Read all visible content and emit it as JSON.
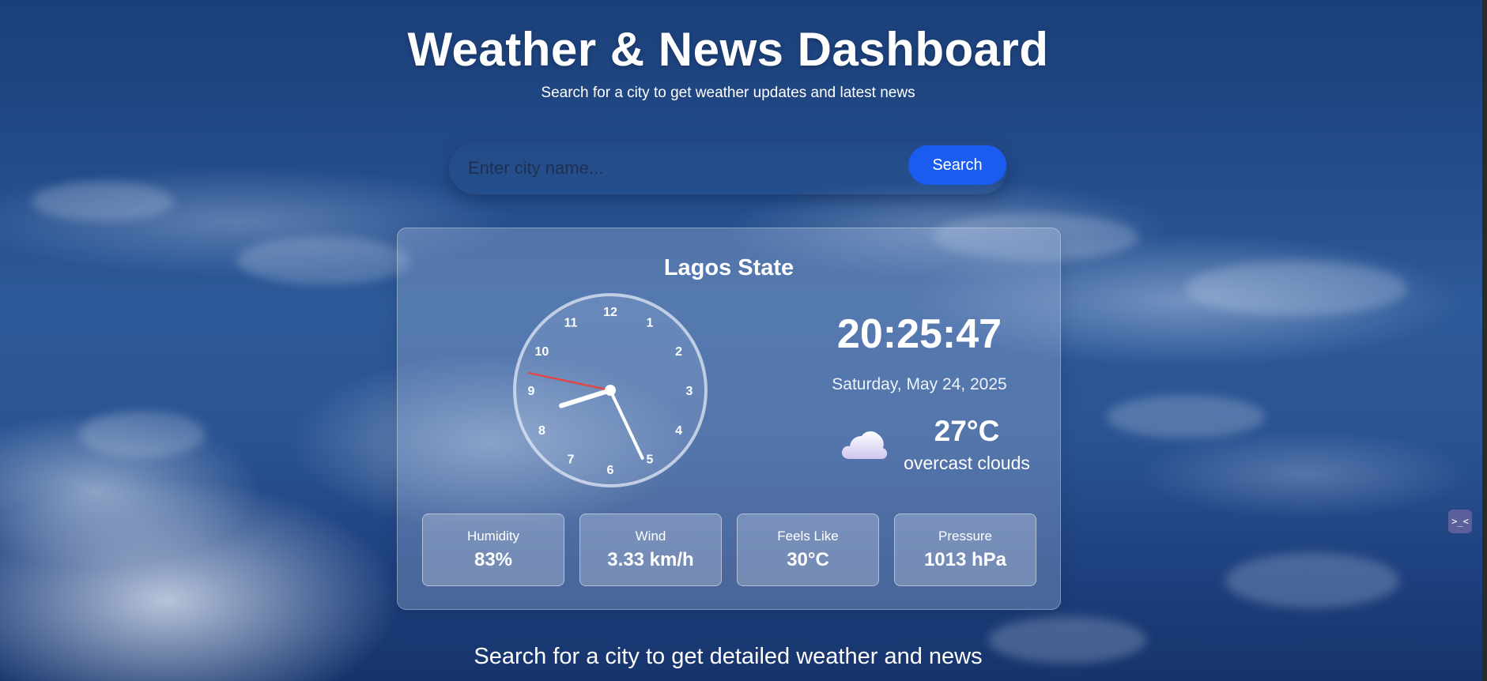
{
  "header": {
    "title": "Weather & News Dashboard",
    "subtitle": "Search for a city to get weather updates and latest news"
  },
  "search": {
    "placeholder": "Enter city name...",
    "value": "",
    "button_label": "Search"
  },
  "weather": {
    "city": "Lagos State",
    "time": "20:25:47",
    "date": "Saturday, May 24, 2025",
    "temperature": "27°C",
    "description": "overcast clouds",
    "icon": "cloud-icon",
    "clock": {
      "hour": 8,
      "minute": 25,
      "second": 47,
      "numerals": [
        "12",
        "1",
        "2",
        "3",
        "4",
        "5",
        "6",
        "7",
        "8",
        "9",
        "10",
        "11"
      ]
    },
    "stats": [
      {
        "label": "Humidity",
        "value": "83%"
      },
      {
        "label": "Wind",
        "value": "3.33 km/h"
      },
      {
        "label": "Feels Like",
        "value": "30°C"
      },
      {
        "label": "Pressure",
        "value": "1013 hPa"
      }
    ]
  },
  "footer": {
    "message": "Search for a city to get detailed weather and news"
  },
  "side_widget": {
    "icon": "terminal-face-icon",
    "glyph": ">_<"
  },
  "colors": {
    "accent": "#1a5cf0",
    "second_hand": "#e04848"
  }
}
